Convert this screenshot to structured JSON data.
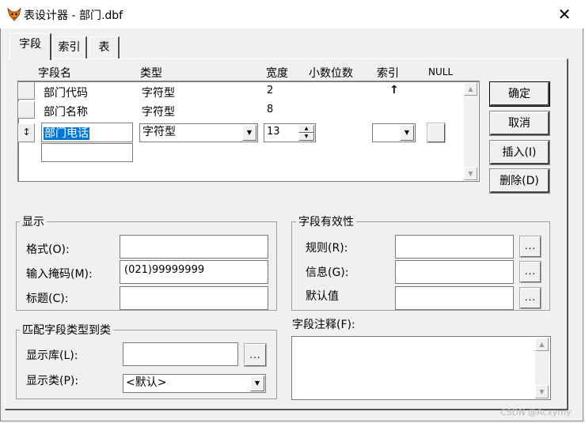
{
  "window": {
    "title": "表设计器 - 部门.dbf",
    "close_glyph": "✕"
  },
  "tabs": [
    {
      "label": "字段"
    },
    {
      "label": "索引"
    },
    {
      "label": "表"
    }
  ],
  "columns": {
    "name": "字段名",
    "type": "类型",
    "width": "宽度",
    "decimals": "小数位数",
    "index": "索引",
    "null": "NULL"
  },
  "rows": [
    {
      "name": "部门代码",
      "type": "字符型",
      "width": "2",
      "index_mark": "↑"
    },
    {
      "name": "部门名称",
      "type": "字符型",
      "width": "8"
    }
  ],
  "edit_row": {
    "selector": "↕",
    "name": "部门电话",
    "type": "字符型",
    "width": "13",
    "index": ""
  },
  "buttons": {
    "ok": "确定",
    "cancel": "取消",
    "insert": "插入(I)",
    "delete": "删除(D)"
  },
  "display": {
    "title": "显示",
    "format_label": "格式(O):",
    "format_value": "",
    "mask_label": "输入掩码(M):",
    "mask_value": "(021)99999999",
    "caption_label": "标题(C):",
    "caption_value": ""
  },
  "validation": {
    "title": "字段有效性",
    "rule_label": "规则(R):",
    "rule_value": "",
    "message_label": "信息(G):",
    "message_value": "",
    "default_label": "默认值",
    "default_value": "",
    "ellipsis": "..."
  },
  "mapping": {
    "title": "匹配字段类型到类",
    "library_label": "显示库(L):",
    "library_value": "",
    "class_label": "显示类(P):",
    "class_value": "<默认>"
  },
  "comment": {
    "label": "字段注释(F):",
    "value": ""
  },
  "watermark": "CSDN @Acxymy"
}
